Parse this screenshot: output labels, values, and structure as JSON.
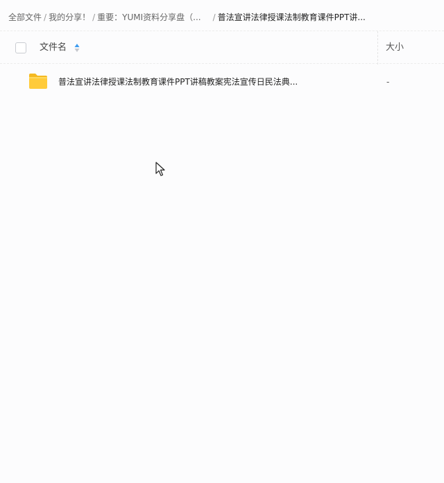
{
  "breadcrumb": {
    "items": [
      "全部文件",
      "我的分享！",
      "重要：YUMI资料分享盘（..."
    ],
    "separator": "/",
    "current": "普法宣讲法律授课法制教育课件PPT讲..."
  },
  "file_list": {
    "header": {
      "name_label": "文件名",
      "size_label": "大小",
      "sort_icon": "sort-arrows-icon"
    },
    "rows": [
      {
        "icon": "folder-icon",
        "name": "普法宣讲法律授课法制教育课件PPT讲稿教案宪法宣传日民法典...",
        "size": "-"
      }
    ]
  },
  "colors": {
    "folder": "#ffcb3a",
    "sort_active": "#3d9cf0"
  }
}
